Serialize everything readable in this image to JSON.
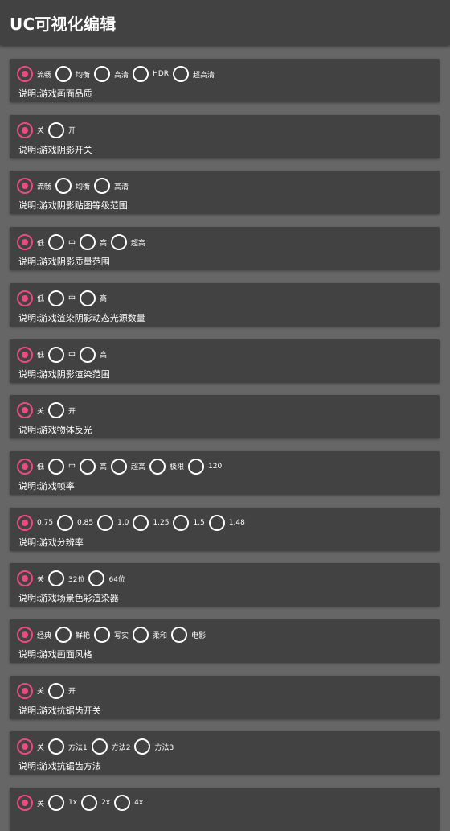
{
  "app": {
    "title": "UC可视化编辑"
  },
  "accent_color": "#ea4c7f",
  "radio_icon": "radio-button",
  "settings": [
    {
      "options": [
        "流畅",
        "均衡",
        "高清",
        "HDR",
        "超高清"
      ],
      "selected": 0,
      "description": "说明:游戏画面品质"
    },
    {
      "options": [
        "关",
        "开"
      ],
      "selected": 0,
      "description": "说明:游戏阴影开关"
    },
    {
      "options": [
        "流畅",
        "均衡",
        "高清"
      ],
      "selected": 0,
      "description": "说明:游戏阴影贴图等级范围"
    },
    {
      "options": [
        "低",
        "中",
        "高",
        "超高"
      ],
      "selected": 0,
      "description": "说明:游戏阴影质量范围"
    },
    {
      "options": [
        "低",
        "中",
        "高"
      ],
      "selected": 0,
      "description": "说明:游戏渲染阴影动态光源数量"
    },
    {
      "options": [
        "低",
        "中",
        "高"
      ],
      "selected": 0,
      "description": "说明:游戏阴影渲染范围"
    },
    {
      "options": [
        "关",
        "开"
      ],
      "selected": 0,
      "description": "说明:游戏物体反光"
    },
    {
      "options": [
        "低",
        "中",
        "高",
        "超高",
        "极限",
        "120"
      ],
      "selected": 0,
      "description": "说明:游戏帧率"
    },
    {
      "options": [
        "0.75",
        "0.85",
        "1.0",
        "1.25",
        "1.5",
        "1.48"
      ],
      "selected": 0,
      "description": "说明:游戏分辨率"
    },
    {
      "options": [
        "关",
        "32位",
        "64位"
      ],
      "selected": 0,
      "description": "说明:游戏场景色彩渲染器"
    },
    {
      "options": [
        "经典",
        "鲜艳",
        "写实",
        "柔和",
        "电影"
      ],
      "selected": 0,
      "description": "说明:游戏画面风格"
    },
    {
      "options": [
        "关",
        "开"
      ],
      "selected": 0,
      "description": "说明:游戏抗锯齿开关"
    },
    {
      "options": [
        "关",
        "方法1",
        "方法2",
        "方法3"
      ],
      "selected": 0,
      "description": "说明:游戏抗锯齿方法"
    },
    {
      "options": [
        "关",
        "1x",
        "2x",
        "4x"
      ],
      "selected": 0,
      "description": ""
    }
  ]
}
